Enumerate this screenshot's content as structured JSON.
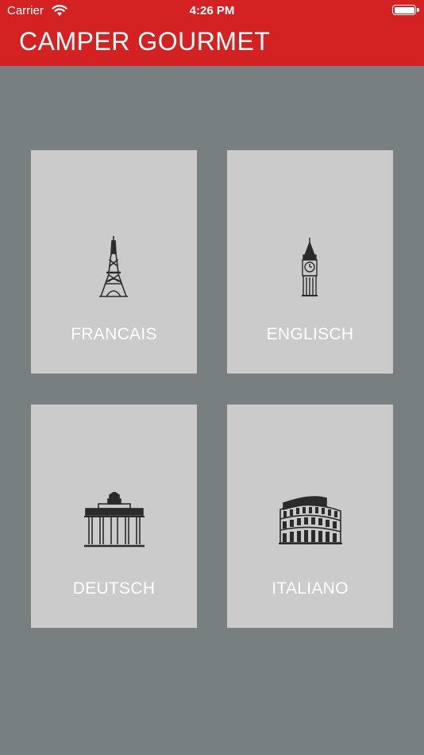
{
  "status_bar": {
    "carrier": "Carrier",
    "time": "4:26 PM",
    "wifi_icon": "wifi-icon",
    "battery_icon": "battery-icon"
  },
  "header": {
    "title": "CAMPER GOURMET",
    "background_color": "#d42121"
  },
  "languages": [
    {
      "label": "FRANCAIS",
      "icon": "eiffel-tower-icon"
    },
    {
      "label": "ENGLISCH",
      "icon": "big-ben-icon"
    },
    {
      "label": "DEUTSCH",
      "icon": "brandenburg-gate-icon"
    },
    {
      "label": "ITALIANO",
      "icon": "colosseum-icon"
    }
  ],
  "colors": {
    "background": "#777f80",
    "tile": "#cbcbcb",
    "icon": "#2b2b2b"
  }
}
